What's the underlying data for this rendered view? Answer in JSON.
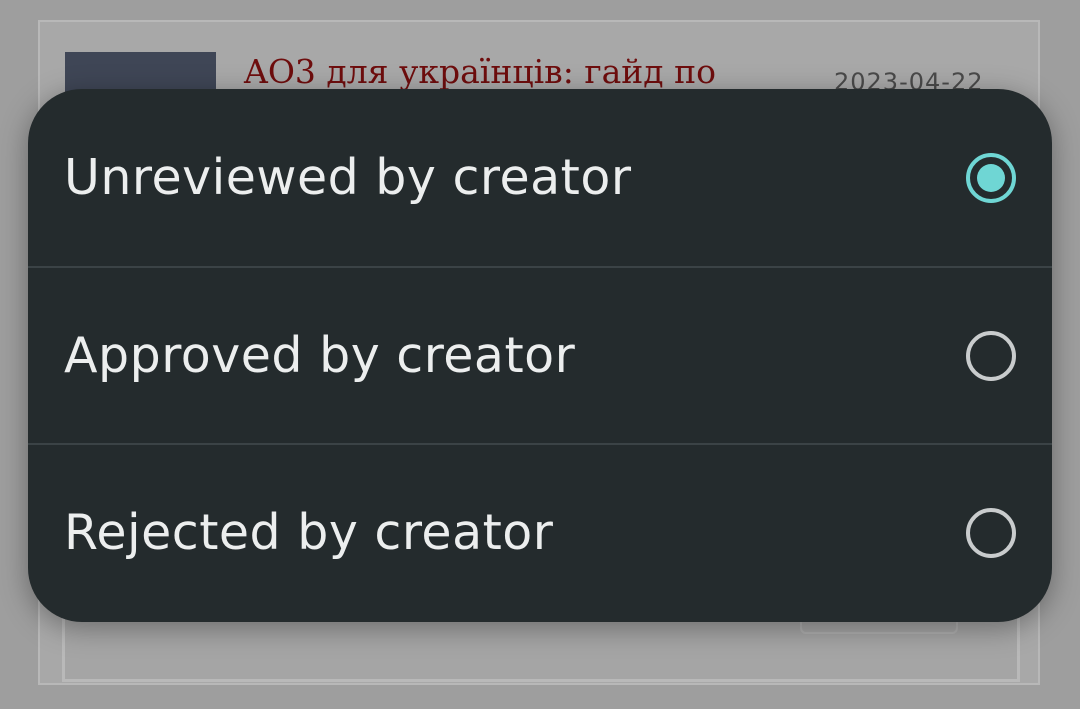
{
  "background": {
    "work_title": "AO3 для українців: гайд по",
    "date": "2023-04-22"
  },
  "dialog": {
    "options": [
      {
        "label": "Unreviewed by creator",
        "selected": true
      },
      {
        "label": "Approved by creator",
        "selected": false
      },
      {
        "label": "Rejected by creator",
        "selected": false
      }
    ]
  },
  "colors": {
    "dialog_bg": "#242b2d",
    "accent": "#6fd6d4",
    "scrim": "#9e9e9e"
  }
}
